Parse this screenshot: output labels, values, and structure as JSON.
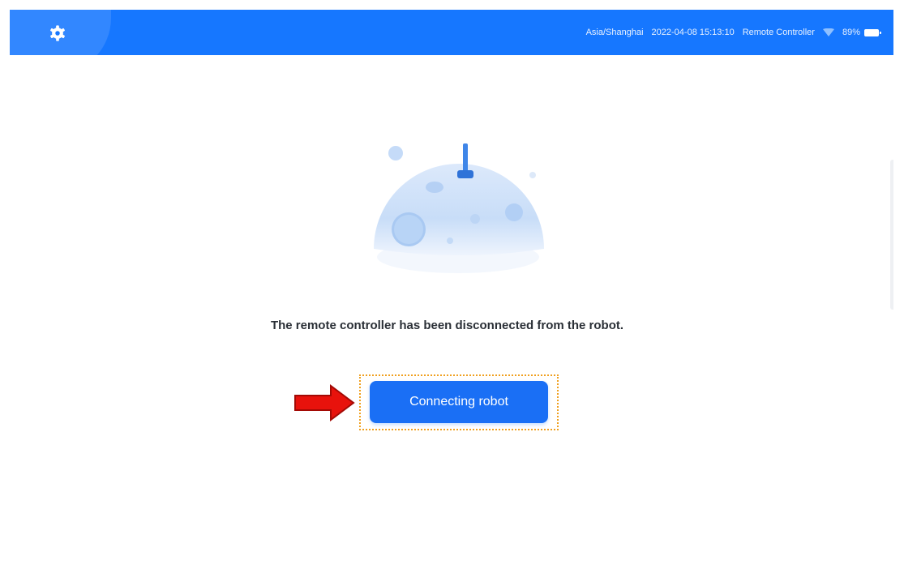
{
  "status_bar": {
    "timezone": "Asia/Shanghai",
    "datetime": "2022-04-08 15:13:10",
    "device": "Remote Controller",
    "battery": "89%"
  },
  "icons": {
    "settings": "gear-icon",
    "wifi": "wifi-icon",
    "battery": "battery-icon",
    "annotation": "arrow-right-icon"
  },
  "main": {
    "message": "The remote controller has been disconnected from the robot.",
    "button_label": "Connecting robot"
  },
  "colors": {
    "primary": "#1677ff",
    "button": "#1a6ff5",
    "annotation_arrow": "#e8120c",
    "highlight_border": "#f0a020"
  }
}
